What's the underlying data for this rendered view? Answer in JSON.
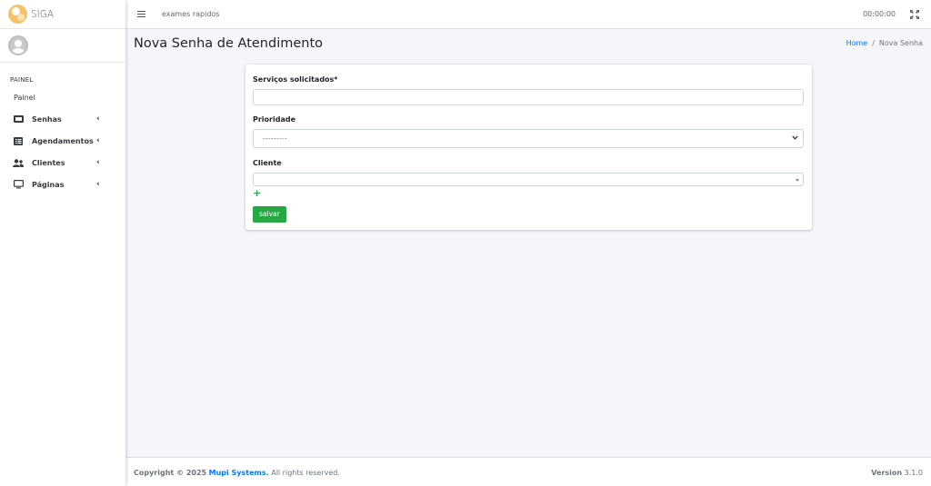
{
  "brand": {
    "name": "SIGA"
  },
  "sidebar": {
    "header": "PAINEL",
    "painel_label": "Painel",
    "items": [
      {
        "label": "Senhas",
        "icon": "ticket-icon"
      },
      {
        "label": "Agendamentos",
        "icon": "list-icon"
      },
      {
        "label": "Clientes",
        "icon": "users-icon"
      },
      {
        "label": "Páginas",
        "icon": "monitor-icon"
      }
    ],
    "caret": "‹"
  },
  "navbar": {
    "link": "exames rapidos",
    "clock": "00:00:00"
  },
  "page": {
    "title": "Nova Senha de Atendimento",
    "breadcrumb": {
      "home": "Home",
      "separator": "/",
      "current": "Nova Senha"
    }
  },
  "form": {
    "servicos_label": "Serviços solicitados*",
    "servicos_value": "",
    "prioridade_label": "Prioridade",
    "prioridade_value": "---------",
    "cliente_label": "Cliente",
    "cliente_value": "",
    "add_label": "+",
    "save_label": "salvar"
  },
  "footer": {
    "copyright": "Copyright © 2025",
    "company": "Mupi Systems.",
    "rights": "All rights reserved.",
    "version_label": "Version",
    "version": "3.1.0"
  },
  "colors": {
    "accent": "#007bff",
    "success": "#28a745",
    "background": "#f4f6f9"
  }
}
